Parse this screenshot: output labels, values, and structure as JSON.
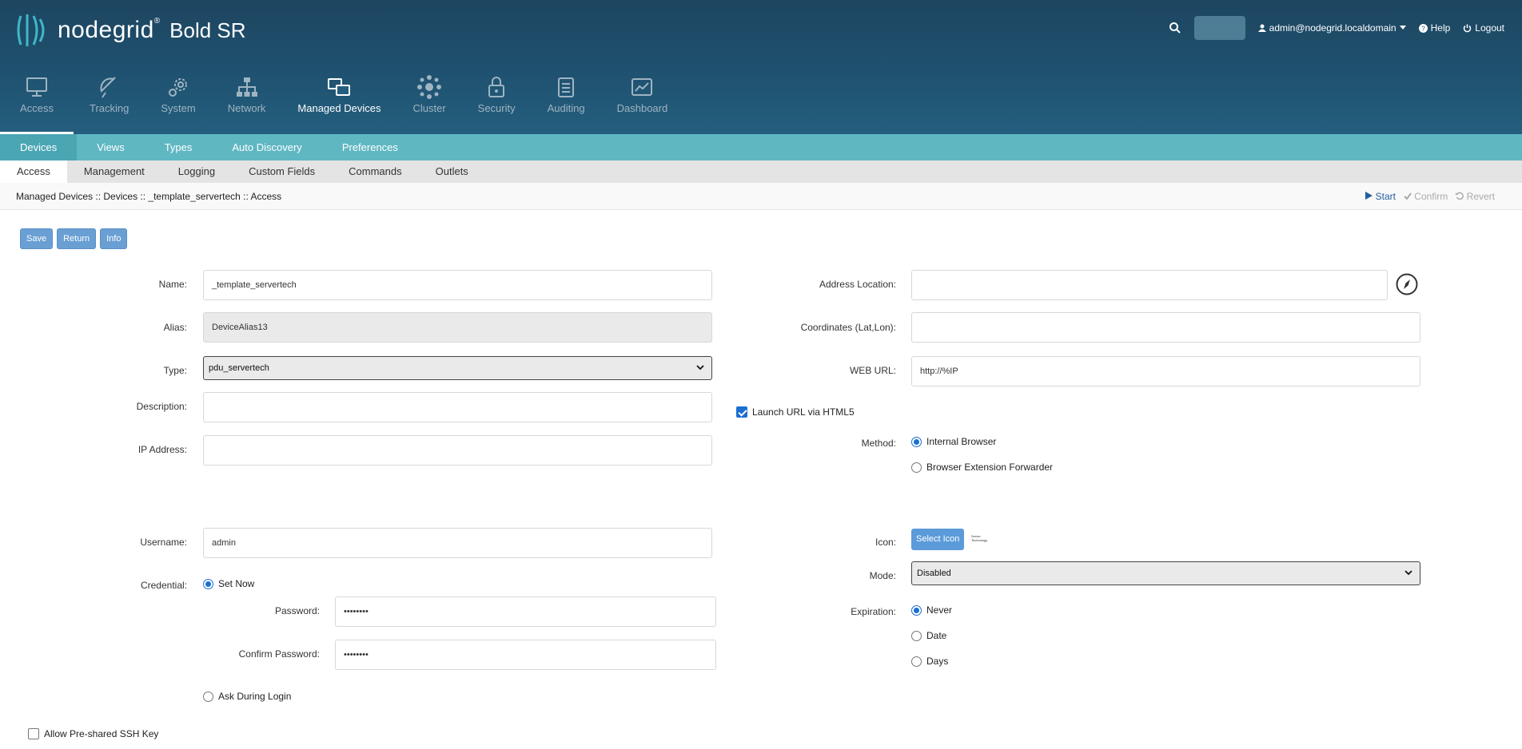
{
  "header": {
    "brand": "nodegrid",
    "registered": "®",
    "product": "Bold SR",
    "user": "admin@nodegrid.localdomain",
    "help": "Help",
    "logout": "Logout"
  },
  "main_nav": [
    {
      "label": "Access",
      "icon": "monitor-icon"
    },
    {
      "label": "Tracking",
      "icon": "satellite-dish-icon"
    },
    {
      "label": "System",
      "icon": "gears-icon"
    },
    {
      "label": "Network",
      "icon": "network-icon"
    },
    {
      "label": "Managed Devices",
      "icon": "devices-icon"
    },
    {
      "label": "Cluster",
      "icon": "cluster-icon"
    },
    {
      "label": "Security",
      "icon": "lock-icon"
    },
    {
      "label": "Auditing",
      "icon": "notepad-icon"
    },
    {
      "label": "Dashboard",
      "icon": "dashboard-icon"
    }
  ],
  "sub_nav": [
    "Devices",
    "Views",
    "Types",
    "Auto Discovery",
    "Preferences"
  ],
  "sub_sub_nav": [
    "Access",
    "Management",
    "Logging",
    "Custom Fields",
    "Commands",
    "Outlets"
  ],
  "breadcrumb": "Managed Devices :: Devices :: _template_servertech :: Access",
  "actions": {
    "start": "Start",
    "confirm": "Confirm",
    "revert": "Revert"
  },
  "buttons": {
    "save": "Save",
    "return": "Return",
    "info": "Info"
  },
  "form": {
    "name_label": "Name:",
    "name": "_template_servertech",
    "alias_label": "Alias:",
    "alias": "DeviceAlias13",
    "type_label": "Type:",
    "type": "pdu_servertech",
    "description_label": "Description:",
    "description": "",
    "ip_label": "IP Address:",
    "ip": "",
    "username_label": "Username:",
    "username": "admin",
    "credential_label": "Credential:",
    "set_now": "Set Now",
    "password_label": "Password:",
    "password": "••••••••",
    "confirm_password_label": "Confirm Password:",
    "confirm_password": "••••••••",
    "ask_login": "Ask During Login",
    "ssh_key": "Allow Pre-shared SSH Key",
    "address_label": "Address Location:",
    "address": "",
    "coords_label": "Coordinates (Lat,Lon):",
    "coords": "",
    "weburl_label": "WEB URL:",
    "weburl": "http://%IP",
    "launch_html5": "Launch URL via HTML5",
    "method_label": "Method:",
    "method_internal": "Internal Browser",
    "method_forwarder": "Browser Extension Forwarder",
    "icon_label": "Icon:",
    "select_icon": "Select Icon",
    "icon_thumb": "Server Technology",
    "mode_label": "Mode:",
    "mode": "Disabled",
    "expiration_label": "Expiration:",
    "exp_never": "Never",
    "exp_date": "Date",
    "exp_days": "Days"
  }
}
